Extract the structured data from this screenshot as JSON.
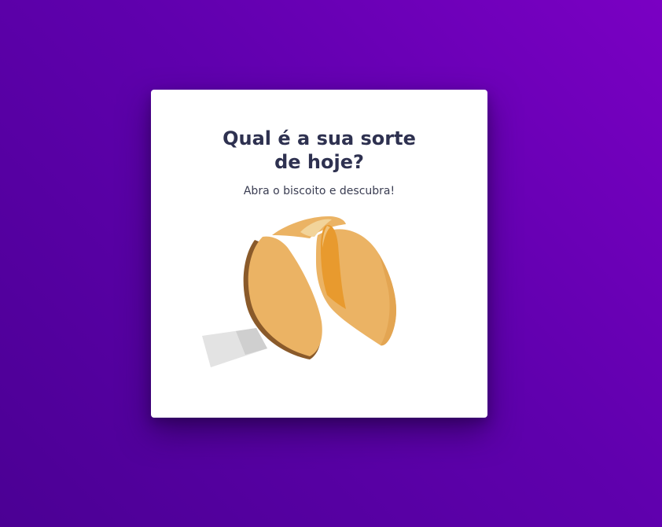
{
  "card": {
    "title": "Qual é a sua sorte de hoje?",
    "subtitle": "Abra o biscoito e descubra!"
  },
  "colors": {
    "background_start": "#7a00c3",
    "background_end": "#4b0094",
    "card": "#ffffff",
    "title": "#2e3150",
    "cookie_main": "#ebb364",
    "cookie_dark": "#8a5a2a",
    "cookie_inner": "#e89a2e",
    "paper": "#e2e2e2"
  },
  "icons": {
    "cookie": "fortune-cookie-icon"
  }
}
